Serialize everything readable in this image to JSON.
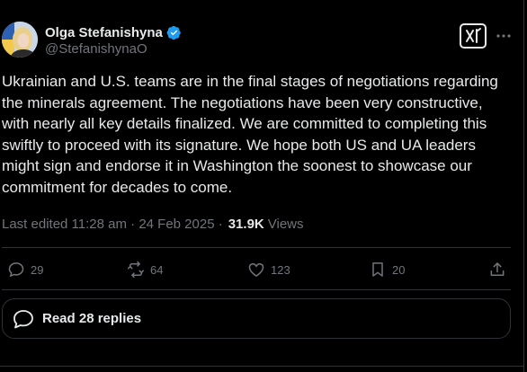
{
  "author": {
    "display_name": "Olga Stefanishyna",
    "handle": "@StefanishynaO",
    "verified": true
  },
  "post": {
    "text": "Ukrainian and U.S. teams are in the final stages of negotiations regarding\nthe minerals agreement. The negotiations have been very constructive,\nwith nearly all key details finalized. We are committed to completing this\nswiftly to proceed with its signature. We hope both US and UA leaders\nmight sign and endorse it in Washington the soonest to showcase our\ncommitment for decades to come."
  },
  "meta": {
    "edited_timestamp": "Last edited 11:28 am · 24 Feb 2025 ·",
    "views_count": "31.9K",
    "views_label": "Views"
  },
  "actions": {
    "replies": "29",
    "reposts": "64",
    "likes": "123",
    "bookmarks": "20"
  },
  "read_replies": {
    "label": "Read 28 replies"
  },
  "colors": {
    "background": "#000000",
    "text": "#e7e9ea",
    "muted": "#71767b",
    "border": "#2f3336",
    "verified": "#1d9bf0"
  },
  "icons": {
    "grok": "grok-icon",
    "more": "more-icon",
    "reply": "reply-icon",
    "repost": "repost-icon",
    "like": "heart-icon",
    "bookmark": "bookmark-icon",
    "share": "share-icon",
    "replies_bubble": "chat-bubble-icon"
  }
}
